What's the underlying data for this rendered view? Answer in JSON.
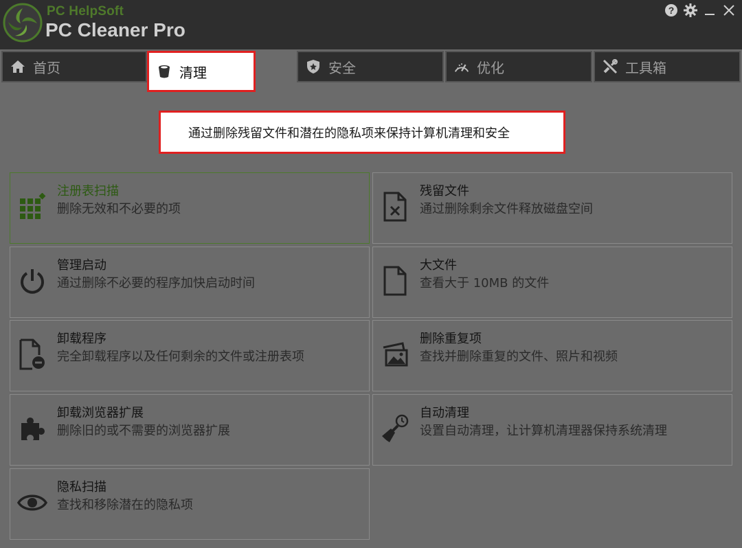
{
  "app": {
    "brand_small": "PC HelpSoft",
    "brand_big": "PC Cleaner Pro"
  },
  "window_controls": [
    "help-icon",
    "gear-icon",
    "minimize-icon",
    "close-icon"
  ],
  "tabs": [
    {
      "label": "首页",
      "icon": "home-icon"
    },
    {
      "label": "清理",
      "icon": "bucket-icon",
      "active": true
    },
    {
      "label": "安全",
      "icon": "shield-icon"
    },
    {
      "label": "优化",
      "icon": "speedometer-icon"
    },
    {
      "label": "工具箱",
      "icon": "tools-icon"
    }
  ],
  "description": "通过删除残留文件和潜在的隐私项来保持计算机清理和安全",
  "cards": [
    {
      "title": "注册表扫描",
      "desc": "删除无效和不必要的项",
      "icon": "registry-grid-icon"
    },
    {
      "title": "残留文件",
      "desc": "通过删除剩余文件释放磁盘空间",
      "icon": "file-x-icon"
    },
    {
      "title": "管理启动",
      "desc": "通过删除不必要的程序加快启动时间",
      "icon": "power-icon"
    },
    {
      "title": "大文件",
      "desc": "查看大于 10MB 的文件",
      "icon": "file-icon"
    },
    {
      "title": "卸载程序",
      "desc": "完全卸载程序以及任何剩余的文件或注册表项",
      "icon": "file-minus-icon"
    },
    {
      "title": "删除重复项",
      "desc": "查找并删除重复的文件、照片和视频",
      "icon": "duplicate-photos-icon"
    },
    {
      "title": "卸载浏览器扩展",
      "desc": "删除旧的或不需要的浏览器扩展",
      "icon": "puzzle-icon"
    },
    {
      "title": "自动清理",
      "desc": "设置自动清理，让计算机清理器保持系统清理",
      "icon": "broom-clock-icon"
    },
    {
      "title": "隐私扫描",
      "desc": "查找和移除潜在的隐私项",
      "icon": "eye-icon"
    }
  ],
  "colors": {
    "accent_green": "#4c7a2b",
    "highlight_red": "#e02020",
    "titlebar": "#2e2e2e",
    "background": "#6b6b6b"
  }
}
